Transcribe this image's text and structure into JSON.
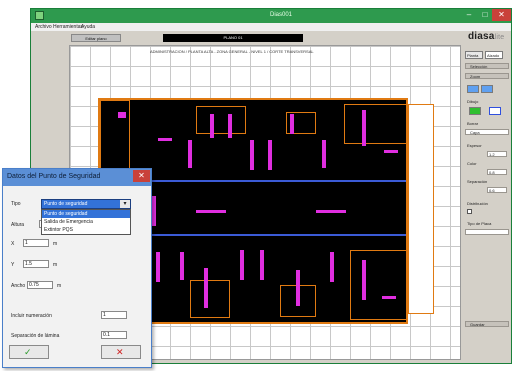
{
  "window": {
    "title": "Dias001"
  },
  "menu": {
    "items": [
      "Archivo",
      "Herramientas",
      "Ayuda"
    ]
  },
  "toolbar": {
    "button_label": "Editar plano",
    "path_field": "PLANO 01"
  },
  "logo": {
    "brand": "diasa",
    "suffix": "lite"
  },
  "canvas": {
    "header_text": "ADMINISTRACION / PLANTA ALTA - ZONA GENERAL - NIVEL 1 / CORTE TRANSVERSAL"
  },
  "sidepanel": {
    "tabs": [
      "Planta",
      "Alzado"
    ],
    "labels": [
      "Selección",
      "Zoom",
      "Dibujo",
      "Borrar",
      "Capa",
      "Espesor",
      "Color",
      "Separación",
      "Distribución",
      "Tipo de Placa",
      "Guardar"
    ],
    "values": [
      "1.2",
      "0.8",
      "0.6"
    ],
    "colors": {
      "green": "#2fbf2f",
      "blue": "#2f4fdf"
    }
  },
  "dialog": {
    "title": "Datos del Punto de Seguridad",
    "type_label": "Tipo",
    "type_value": "Punto de seguridad",
    "type_options": [
      "Punto de seguridad",
      "Salida de Emergencia",
      "Extintor PQS"
    ],
    "fields": [
      {
        "label": "Altura",
        "value": ""
      },
      {
        "label": "X",
        "value": "1"
      },
      {
        "label": "Y",
        "value": "1.5"
      },
      {
        "label": "Ancho",
        "value": "0.75"
      }
    ],
    "units": "m",
    "numbering_label": "Incluir numeración",
    "numbering_value": "1",
    "spacing_label": "Separación de lámina",
    "spacing_value": "0.1",
    "ok_glyph": "✓",
    "cancel_glyph": "✕"
  }
}
